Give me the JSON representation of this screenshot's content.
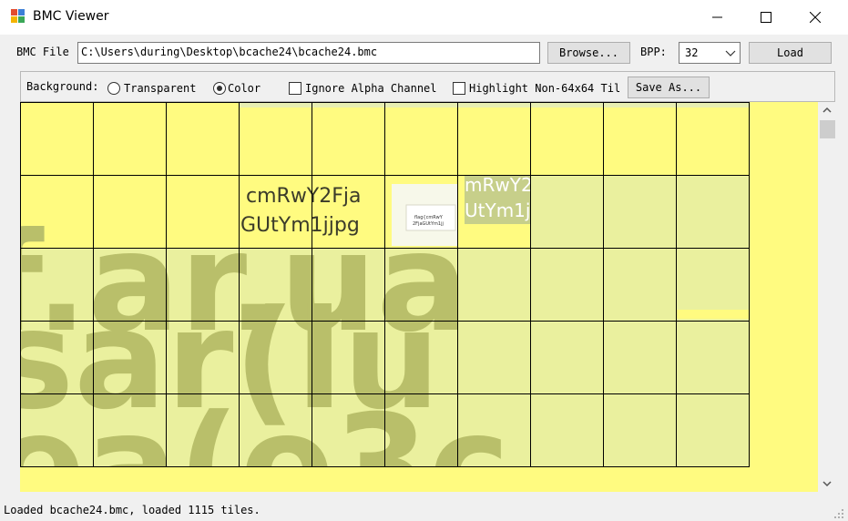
{
  "window": {
    "title": "BMC Viewer"
  },
  "file_row": {
    "label": "BMC File",
    "path": "C:\\Users\\during\\Desktop\\bcache24\\bcache24.bmc",
    "browse_label": "Browse...",
    "bpp_label": "BPP:",
    "bpp_value": "32",
    "load_label": "Load"
  },
  "options_row": {
    "background_label": "Background:",
    "transparent_label": "Transparent",
    "transparent_checked": false,
    "color_label": "Color",
    "color_checked": true,
    "ignore_alpha_label": "Ignore Alpha Channel",
    "ignore_alpha_checked": false,
    "highlight_label": "Highlight Non-64x64 Til",
    "highlight_checked": false,
    "save_as_label": "Save As..."
  },
  "viewer": {
    "tile_text_line1": "cmRwY2Fja",
    "tile_text_line2": "GUtYm1jjpg",
    "tile_partial_line1": "mRwY2",
    "tile_partial_line2": "UtYm1j",
    "thumb_line1": "flag{cmRwY",
    "thumb_line2": "2FjaGUtYm1jj",
    "colors": {
      "yellow": "#fffb80",
      "pale": "#eaf09e",
      "glyph": "#b9bf6a",
      "grid": "#000000"
    }
  },
  "status": {
    "text": "Loaded bcache24.bmc, loaded 1115 tiles."
  }
}
